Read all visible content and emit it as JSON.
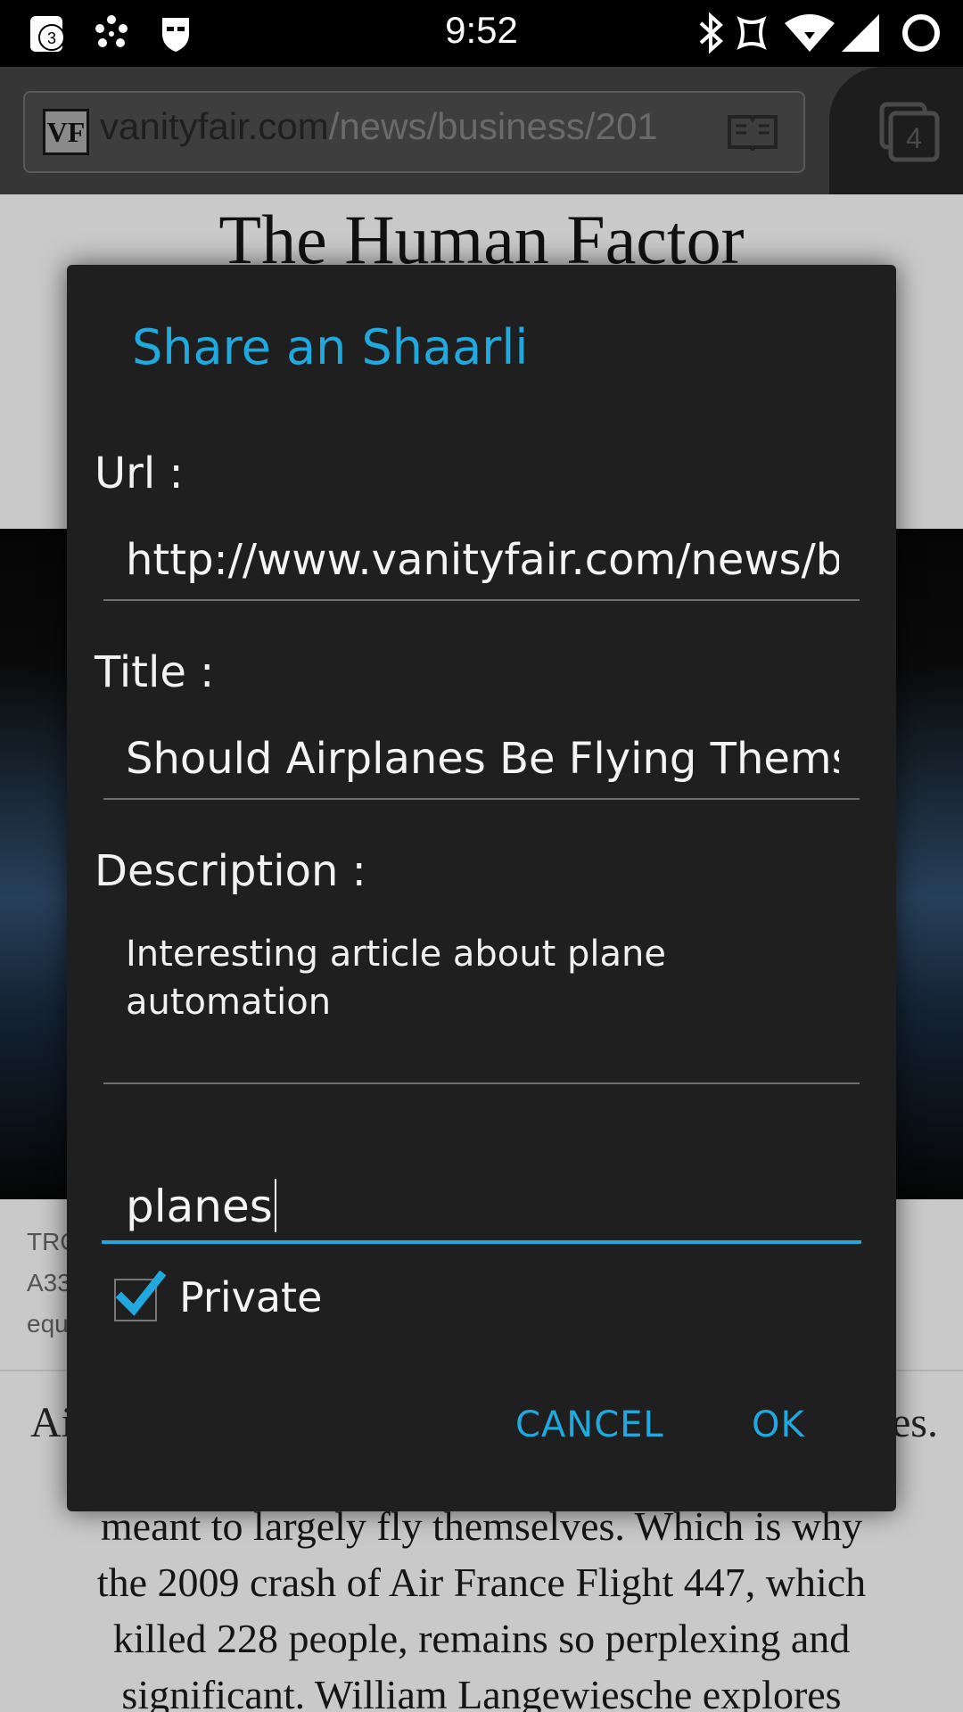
{
  "status_bar": {
    "time": "9:52",
    "notification_count": "3",
    "icons": [
      "notification-badge-icon",
      "dots-app-icon",
      "shield-app-icon",
      "bluetooth-icon",
      "nfc-icon",
      "wifi-icon",
      "signal-icon",
      "battery-ring-icon"
    ]
  },
  "browser": {
    "site_logo": "VF",
    "url_domain": "vanityfair.com",
    "url_path": "/news/business/201",
    "tab_count": "4"
  },
  "page": {
    "title": "The Human Factor",
    "caption_lines": [
      "TRO",
      "A33",
      "equ"
    ],
    "lead_left": "Ai",
    "lead_right": "es.",
    "body_lines": [
      "meant to largely fly themselves. Which is why",
      "the 2009 crash of Air France Flight 447, which",
      "killed 228 people, remains so perplexing and",
      "significant. William Langewiesche explores"
    ]
  },
  "dialog": {
    "title": "Share an Shaarli",
    "url_label": "Url :",
    "url_value": "http://www.vanityfair.com/news/b",
    "title_label": "Title :",
    "title_value": "Should Airplanes Be Flying Thems",
    "description_label": "Description :",
    "description_value": "Interesting article about plane automation",
    "tags_value": "planes",
    "private_label": "Private",
    "private_checked": true,
    "cancel_label": "CANCEL",
    "ok_label": "OK",
    "accent_color": "#1fa9df"
  }
}
